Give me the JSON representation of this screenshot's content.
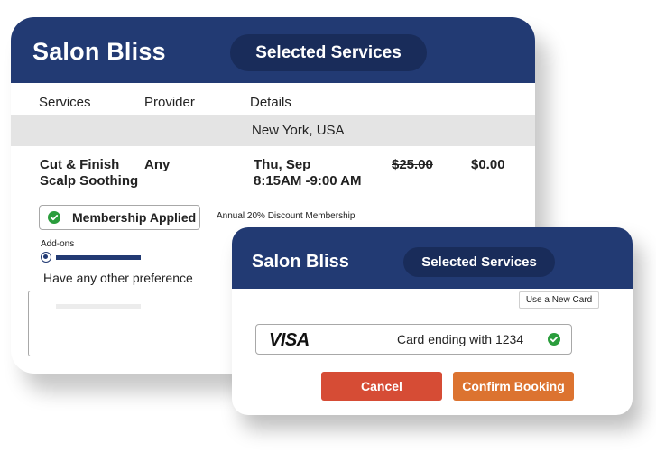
{
  "back_card": {
    "brand": "Salon Bliss",
    "pill": "Selected Services",
    "columns": {
      "services": "Services",
      "provider": "Provider",
      "details": "Details"
    },
    "location": "New York, USA",
    "service_lines": [
      "Cut & Finish",
      "Scalp Soothing"
    ],
    "provider": "Any",
    "detail_lines": [
      "Thu, Sep",
      "8:15AM -9:00 AM"
    ],
    "price_original": "$25.00",
    "price_final": "$0.00",
    "membership_badge": "Membership Applied",
    "discount_note": "Annual 20% Discount Membership",
    "addons_label": "Add-ons",
    "preference_label": "Have any other preference"
  },
  "front_card": {
    "brand": "Salon Bliss",
    "pill": "Selected Services",
    "new_card_button": "Use a New Card",
    "card_brand": "VISA",
    "card_text": "Card ending with 1234",
    "cancel_button": "Cancel",
    "confirm_button": "Confirm Booking"
  },
  "colors": {
    "header": "#223a73",
    "pill": "#192c5a",
    "check": "#2a9d3c",
    "cancel": "#d64c35",
    "confirm": "#dc7330"
  }
}
